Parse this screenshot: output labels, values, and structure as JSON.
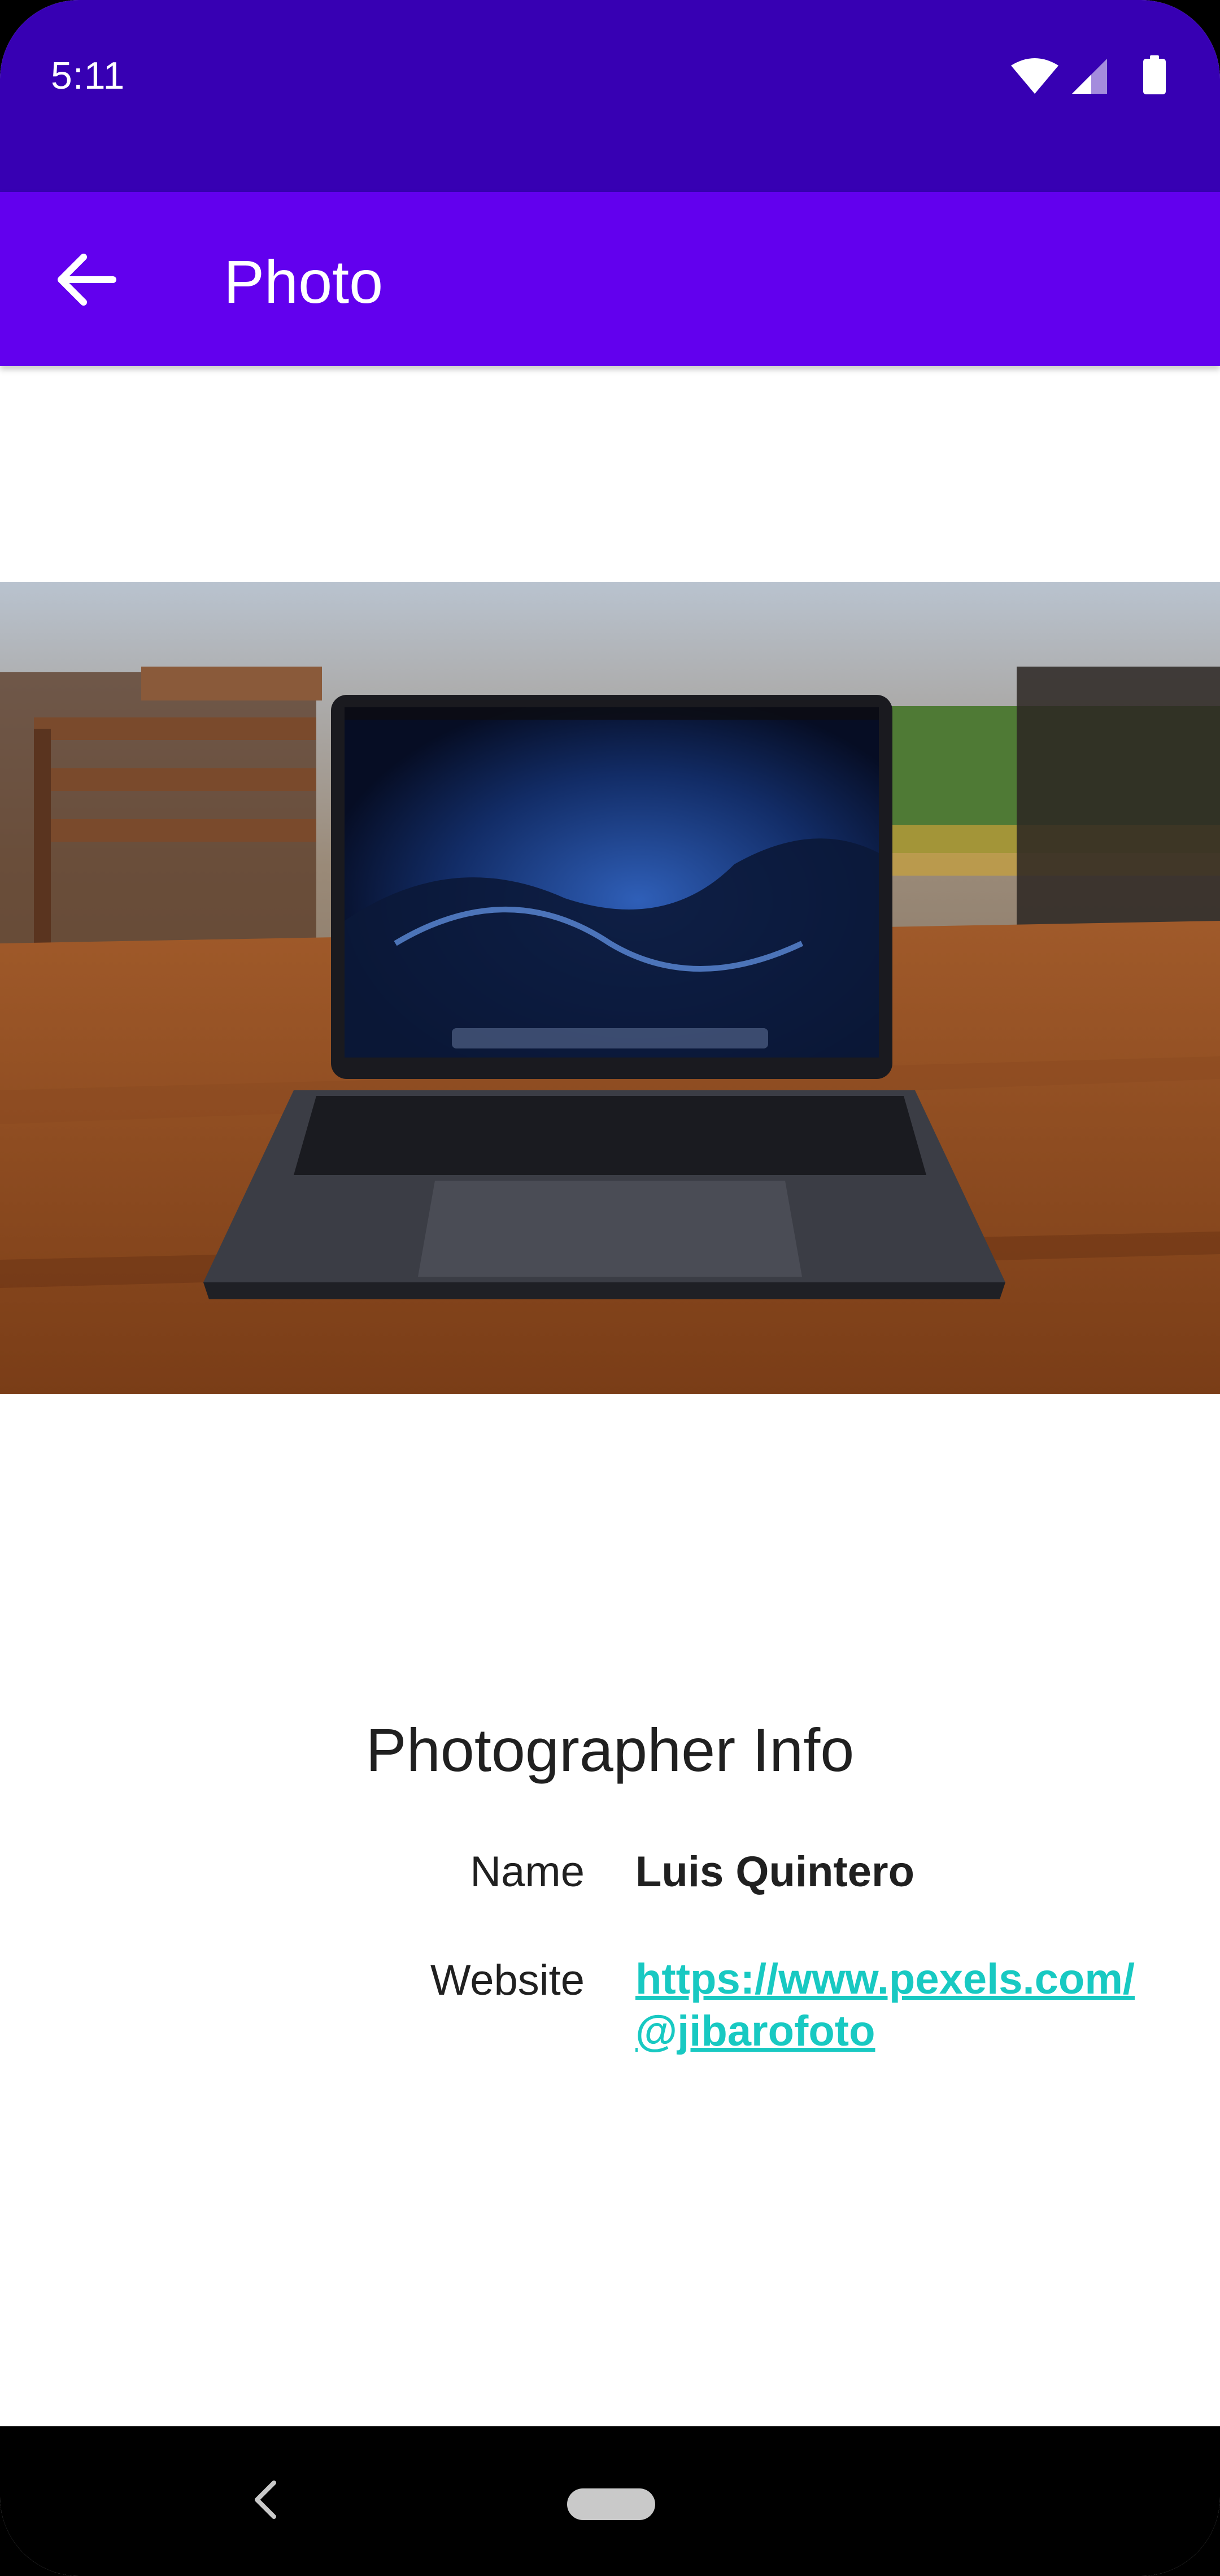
{
  "status_bar": {
    "time": "5:11",
    "icons": [
      "wifi-icon",
      "signal-icon",
      "battery-icon"
    ],
    "color": "#3700b3"
  },
  "app_bar": {
    "title": "Photo",
    "back_icon": "arrow-back-icon",
    "color": "#6200ee"
  },
  "photo": {
    "subject": "laptop-on-wooden-table"
  },
  "info": {
    "title": "Photographer Info",
    "name_label": "Name",
    "name_value": "Luis Quintero",
    "website_label": "Website",
    "website_value": "https://www.pexels.com/@jibarofoto",
    "link_color": "#18c9c2"
  },
  "nav_bar": {
    "back_icon": "nav-back-icon",
    "home_icon": "nav-home-pill"
  }
}
